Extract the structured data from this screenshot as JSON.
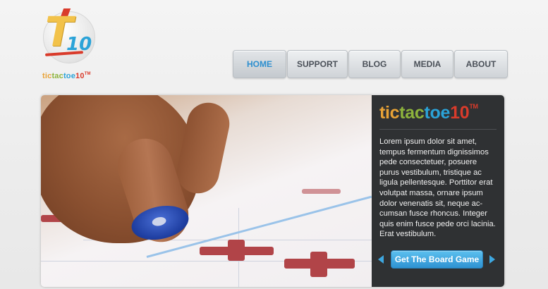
{
  "logo": {
    "mark_letter": "T",
    "mark_number": "10",
    "wordmark_parts": [
      "tic",
      "tac",
      "toe",
      "10"
    ],
    "trademark": "TM"
  },
  "nav": {
    "items": [
      {
        "label": "HOME",
        "active": true
      },
      {
        "label": "SUPPORT",
        "active": false
      },
      {
        "label": "BLOG",
        "active": false
      },
      {
        "label": "MEDIA",
        "active": false
      },
      {
        "label": "ABOUT",
        "active": false
      }
    ]
  },
  "hero": {
    "image_alt_icon": "hand-placing-game-piece-image",
    "title_parts": [
      "tic",
      "tac",
      "toe",
      "10"
    ],
    "trademark": "TM",
    "description": "Lorem ipsum dolor sit amet, tempus fermentum dignissimos pede consectetuer, posuere purus vestibulum, tristique ac ligula pellentesque. Porttitor erat volutpat massa, ornare ipsum dolor venenatis sit, neque ac-cumsan fusce rhoncus. Integer quis enim fusce pede orci lacinia. Erat vestibulum.",
    "cta_label": "Get The Board Game"
  },
  "colors": {
    "accent_blue": "#2ba3d8",
    "accent_orange": "#e8a236",
    "accent_green": "#8db33c",
    "accent_red": "#d93b2b",
    "panel_bg": "#2f3133"
  }
}
